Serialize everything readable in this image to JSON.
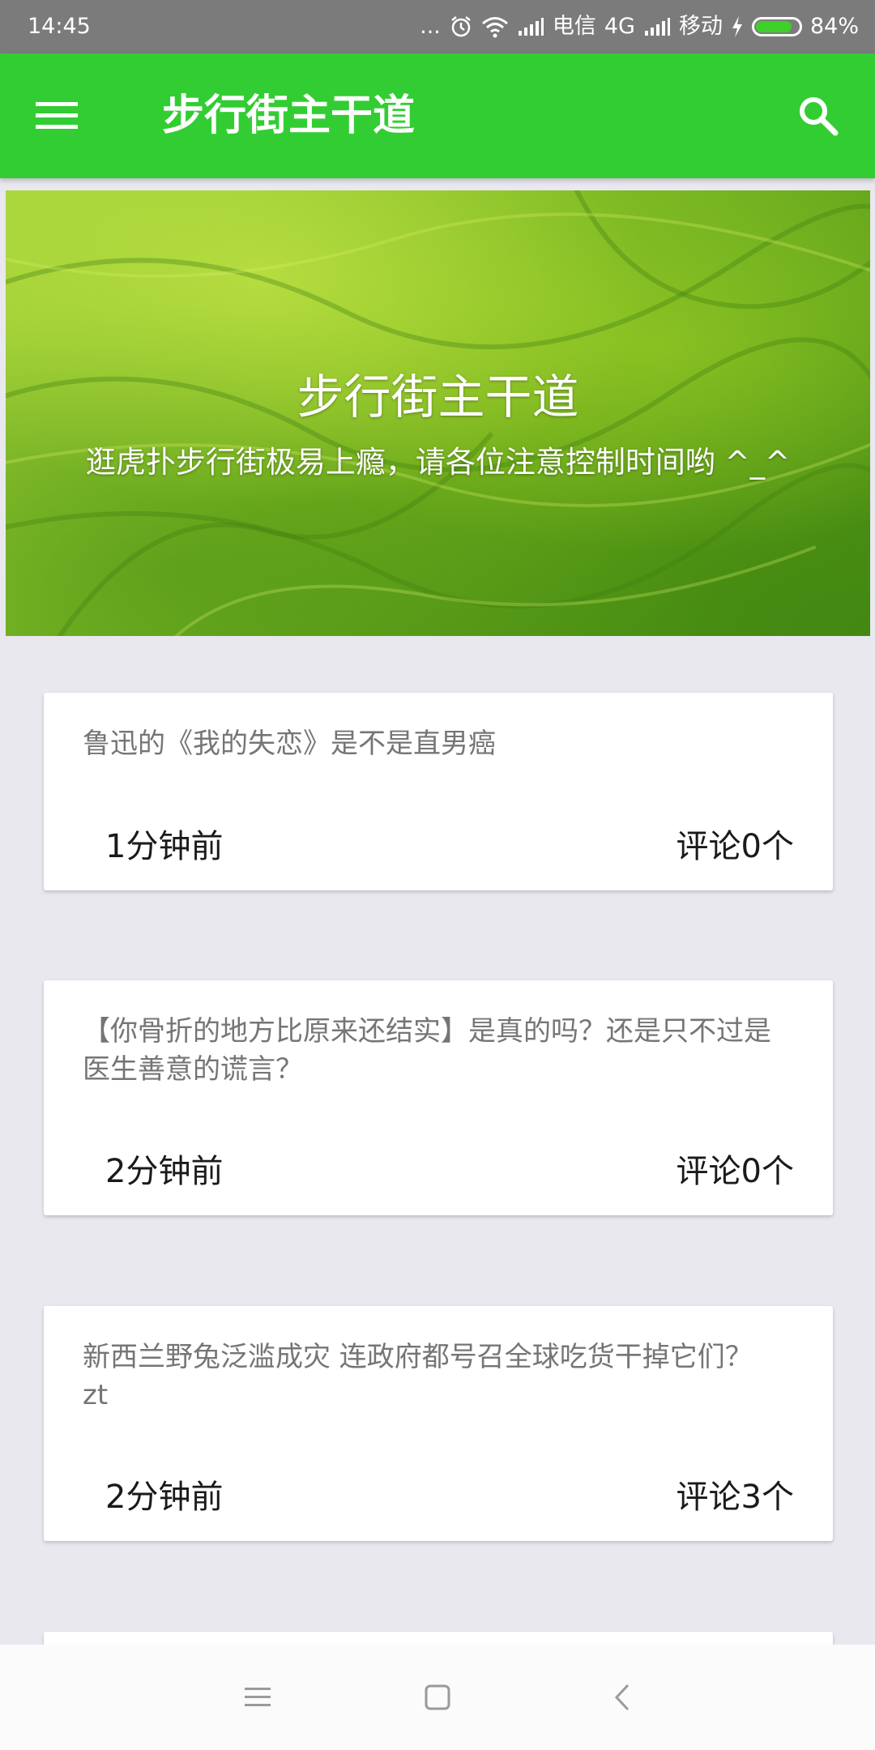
{
  "status_bar": {
    "time": "14:45",
    "dots": "...",
    "carrier1": "电信",
    "network1": "4G",
    "carrier2": "移动",
    "battery_percent": "84%",
    "battery_level": 0.84,
    "battery_color": "#3ecf2a"
  },
  "app_bar": {
    "title": "步行街主干道",
    "menu_icon": "hamburger-menu-icon",
    "search_icon": "search-icon",
    "color": "#32cd32"
  },
  "banner": {
    "title": "步行街主干道",
    "subtitle": "逛虎扑步行街极易上瘾，请各位注意控制时间哟 ^_^"
  },
  "posts": [
    {
      "title": "鲁迅的《我的失恋》是不是直男癌",
      "time": "1分钟前",
      "comments": "评论0个"
    },
    {
      "title": "【你骨折的地方比原来还结实】是真的吗？还是只不过是医生善意的谎言？",
      "time": "2分钟前",
      "comments": "评论0个"
    },
    {
      "title": "新西兰野兔泛滥成灾 连政府都号召全球吃货干掉它们？zt",
      "time": "2分钟前",
      "comments": "评论3个"
    }
  ],
  "nav_bar": {
    "recents_icon": "recents-icon",
    "home_icon": "home-icon",
    "back_icon": "back-icon"
  }
}
